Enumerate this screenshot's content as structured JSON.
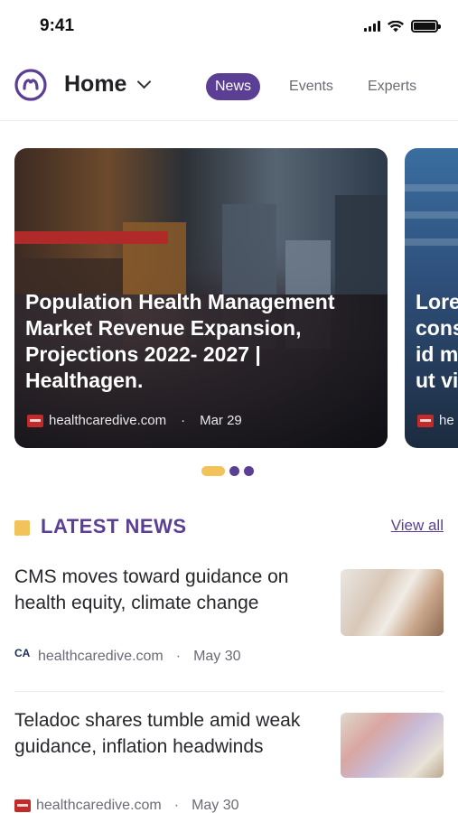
{
  "status_bar": {
    "time": "9:41"
  },
  "header": {
    "title": "Home",
    "tabs": [
      {
        "label": "News",
        "active": true
      },
      {
        "label": "Events",
        "active": false
      },
      {
        "label": "Experts",
        "active": false
      }
    ]
  },
  "carousel": {
    "cards": [
      {
        "title": "Population Health Management Market Revenue Expansion, Projections 2022- 2027 | Healthagen.",
        "source": "healthcaredive.com",
        "separator": "·",
        "date": "Mar 29"
      },
      {
        "title_lines": [
          "Lore",
          "cons",
          "id m",
          "ut vi"
        ],
        "source": "he"
      }
    ],
    "dots": {
      "count": 3,
      "active_index": 0
    }
  },
  "latest_news": {
    "title": "LATEST NEWS",
    "view_all": "View all",
    "items": [
      {
        "title": "CMS moves toward guidance on health equity, climate change",
        "source": "healthcaredive.com",
        "separator": "·",
        "date": "May 30",
        "source_icon": "CA"
      },
      {
        "title": "Teladoc shares tumble amid weak guidance, inflation headwinds",
        "source": "healthcaredive.com",
        "separator": "·",
        "date": "May 30"
      }
    ]
  },
  "colors": {
    "brand_purple": "#5b3f94",
    "accent_yellow": "#f2c35a",
    "text_dark": "#26262c",
    "text_muted": "#6b6b75"
  }
}
